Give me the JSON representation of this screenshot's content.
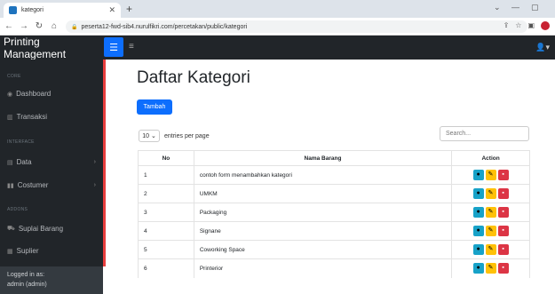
{
  "browser": {
    "tab_title": "kategori",
    "url": "peserta12-fwd-sib4.nurulfikri.com/percetakan/public/kategori"
  },
  "app": {
    "brand": "Printing Management"
  },
  "sidebar": {
    "sections": [
      {
        "heading": "CORE",
        "items": [
          {
            "label": "Dashboard",
            "icon": "dashboard-icon"
          },
          {
            "label": "Transaksi",
            "icon": "chart-icon"
          }
        ]
      },
      {
        "heading": "INTERFACE",
        "items": [
          {
            "label": "Data",
            "icon": "columns-icon"
          },
          {
            "label": "Costumer",
            "icon": "book-icon"
          }
        ]
      },
      {
        "heading": "ADDONS",
        "items": [
          {
            "label": "Suplai Barang",
            "icon": "cart-icon"
          },
          {
            "label": "Suplier",
            "icon": "truck-icon"
          }
        ]
      }
    ],
    "footer_line1": "Logged in as:",
    "footer_line2": "admin (admin)"
  },
  "main": {
    "title": "Daftar Kategori",
    "add_button": "Tambah",
    "entries_value": "10",
    "entries_text": "entries per page",
    "search_placeholder": "Search...",
    "table": {
      "headers": [
        "No",
        "Nama Barang",
        "Action"
      ],
      "rows": [
        {
          "no": "1",
          "name": "contoh form menambahkan kategori"
        },
        {
          "no": "2",
          "name": "UMKM"
        },
        {
          "no": "3",
          "name": "Packaging"
        },
        {
          "no": "4",
          "name": "Signane"
        },
        {
          "no": "5",
          "name": "Coworking Space"
        },
        {
          "no": "6",
          "name": "Printerior"
        }
      ]
    }
  },
  "colors": {
    "primary": "#0d6efd",
    "sidebar": "#212529",
    "view": "#17a2c8",
    "edit": "#ffc107",
    "delete": "#dc3545"
  }
}
